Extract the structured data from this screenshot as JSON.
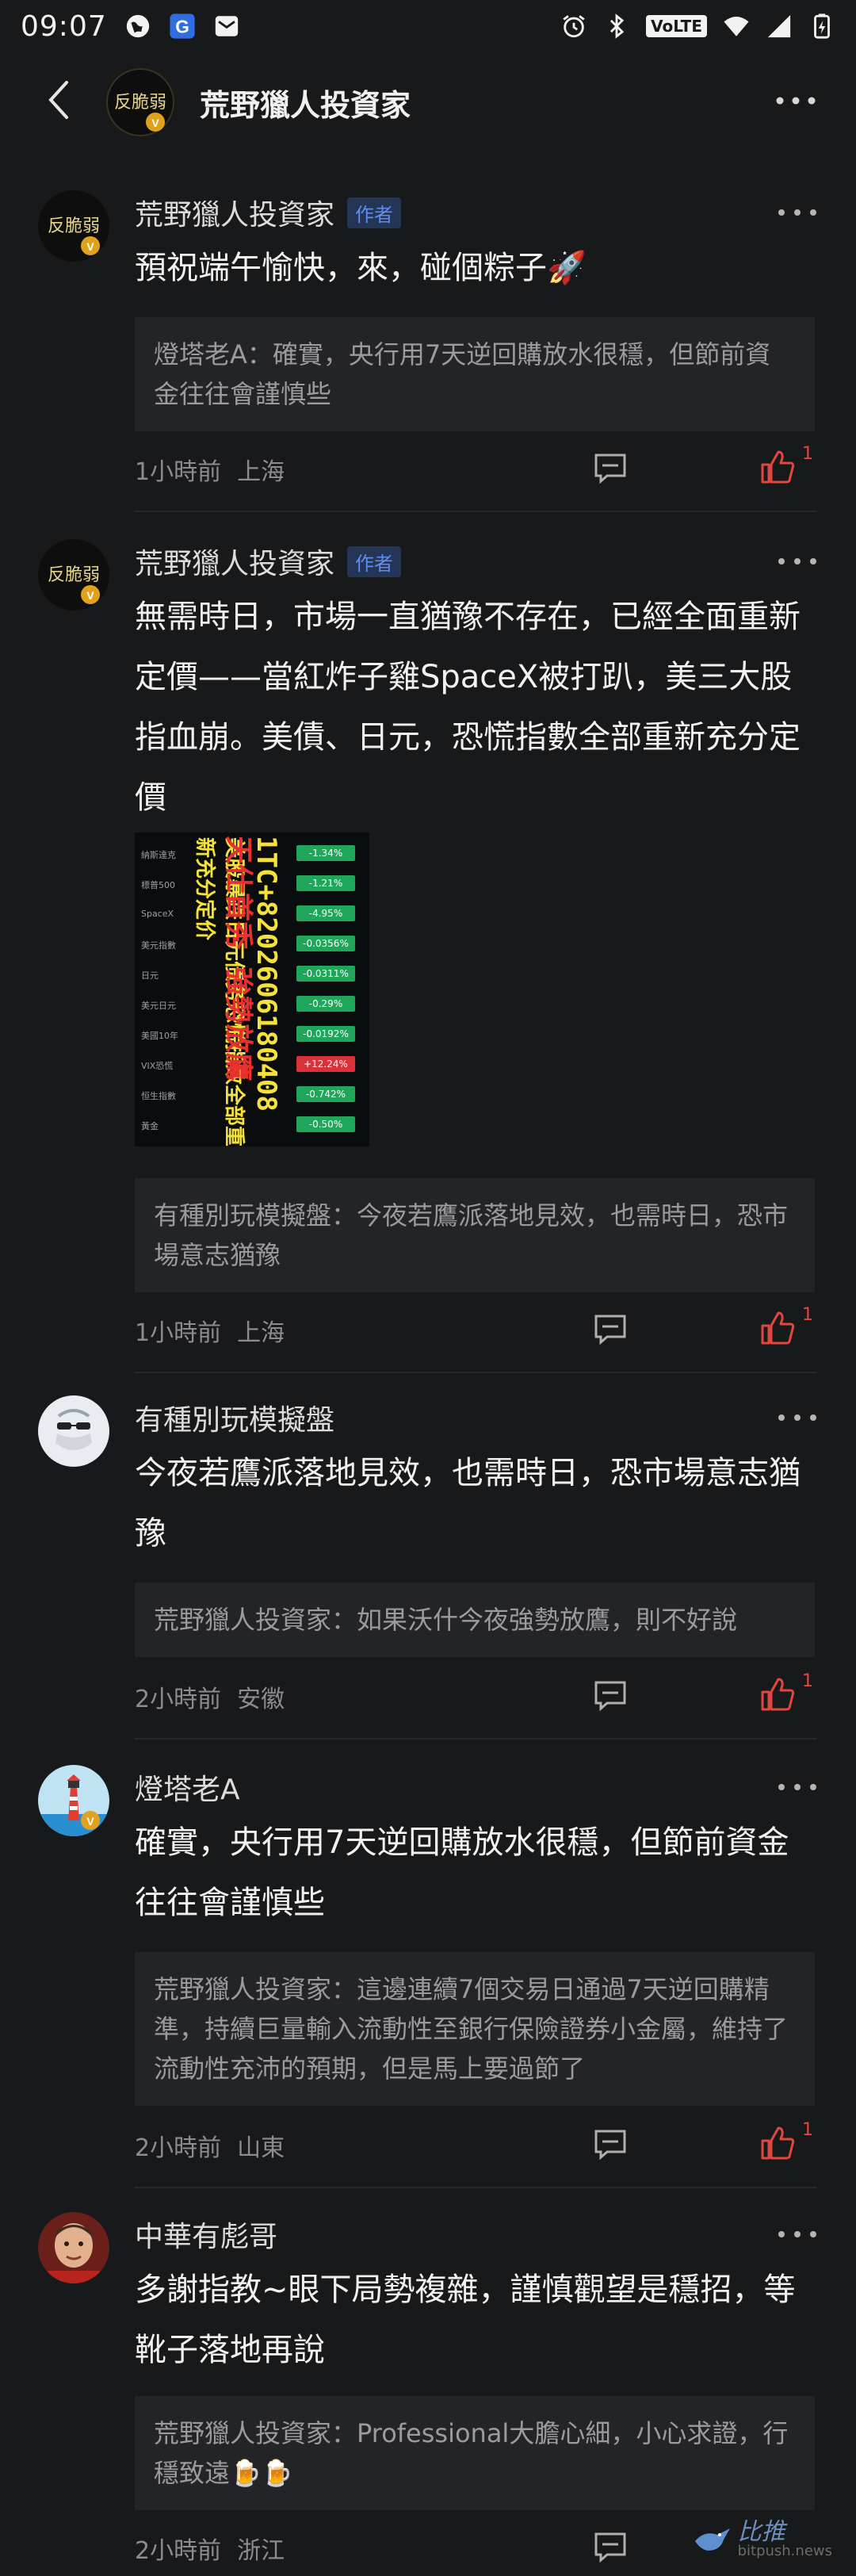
{
  "status_bar": {
    "time": "09:07",
    "network_badge": "VoLTE"
  },
  "nav": {
    "title": "荒野獵人投資家",
    "avatar_text": "反脆弱"
  },
  "comments": [
    {
      "author": "荒野獵人投資家",
      "badge": "作者",
      "avatar_text": "反脆弱",
      "content": "預祝端午愉快，來，碰個粽子🚀",
      "reply": "燈塔老A：確實，央行用7天逆回購放水很穩，但節前資金往往會謹慎些",
      "time": "1小時前",
      "location": "上海",
      "likes": "1"
    },
    {
      "author": "荒野獵人投資家",
      "badge": "作者",
      "avatar_text": "反脆弱",
      "content": "無需時日，市場一直猶豫不存在，已經全面重新定價——當紅炸子雞SpaceX被打趴，美三大股指血崩。美債、日元，恐慌指數全部重新充分定價",
      "image": {
        "overlay_green": "1TC+8202606180408",
        "overlay_red": "天仕首秀 強勢放鷹",
        "overlay_yellow": "美股暴跌日元债务恐慌指数全部重新充分定价",
        "rows": [
          {
            "label": "納斯達克",
            "value": "-1.34%",
            "color": "#1fa65a"
          },
          {
            "label": "標普500",
            "value": "-1.21%",
            "color": "#1fa65a"
          },
          {
            "label": "SpaceX",
            "value": "-4.95%",
            "color": "#1fa65a"
          },
          {
            "label": "美元指數",
            "value": "-0.0356%",
            "color": "#1fa65a"
          },
          {
            "label": "日元",
            "value": "-0.0311%",
            "color": "#1fa65a"
          },
          {
            "label": "美元日元",
            "value": "-0.29%",
            "color": "#1fa65a"
          },
          {
            "label": "美國10年",
            "value": "-0.0192%",
            "color": "#1fa65a"
          },
          {
            "label": "VIX恐慌",
            "value": "+12.24%",
            "color": "#d9323a"
          },
          {
            "label": "恒生指數",
            "value": "-0.742%",
            "color": "#1fa65a"
          },
          {
            "label": "黃金",
            "value": "-0.50%",
            "color": "#1fa65a"
          }
        ]
      },
      "reply": "有種別玩模擬盤：今夜若鷹派落地見效，也需時日，恐市場意志猶豫",
      "time": "1小時前",
      "location": "上海",
      "likes": "1"
    },
    {
      "author": "有種別玩模擬盤",
      "avatar_text": "",
      "content": "今夜若鷹派落地見效，也需時日，恐市場意志猶豫",
      "reply": "荒野獵人投資家：如果沃什今夜強勢放鷹，則不好說",
      "time": "2小時前",
      "location": "安徽",
      "likes": "1"
    },
    {
      "author": "燈塔老A",
      "avatar_text": "",
      "content": "確實，央行用7天逆回購放水很穩，但節前資金往往會謹慎些",
      "reply": "荒野獵人投資家：這邊連續7個交易日通過7天逆回購精準，持續巨量輸入流動性至銀行保險證券小金屬，維持了流動性充沛的預期，但是馬上要過節了",
      "time": "2小時前",
      "location": "山東",
      "likes": "1"
    },
    {
      "author": "中華有彪哥",
      "avatar_text": "",
      "content": "多謝指教~眼下局勢複雜，謹慎觀望是穩招，等靴子落地再說",
      "reply": "荒野獵人投資家：Professional大膽心細，小心求證，行穩致遠🍺🍺",
      "time": "2小時前",
      "location": "浙江",
      "likes": "1"
    }
  ],
  "watermark": {
    "text": "比推",
    "sub": "bitpush.news"
  }
}
